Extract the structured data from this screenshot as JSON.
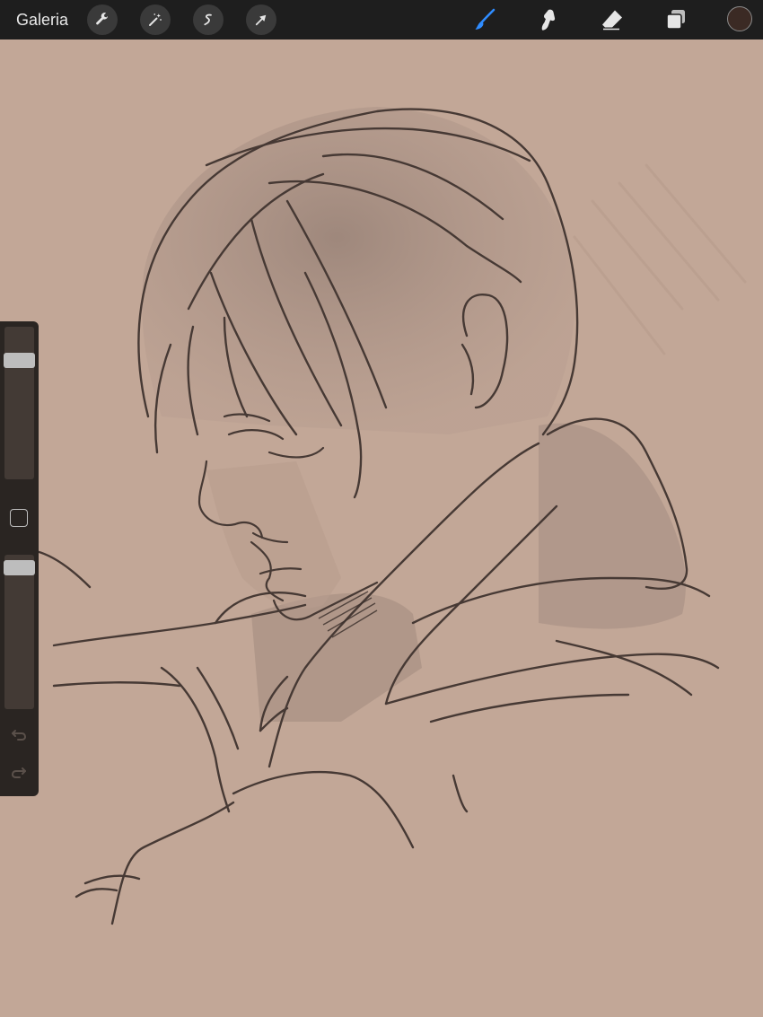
{
  "toolbar": {
    "gallery_label": "Galeria",
    "left_tools": [
      {
        "icon": "wrench-icon"
      },
      {
        "icon": "magic-wand-icon"
      },
      {
        "icon": "selection-s-icon"
      },
      {
        "icon": "transform-arrow-icon"
      }
    ],
    "right_tools": [
      {
        "icon": "brush-icon",
        "active": true
      },
      {
        "icon": "smudge-icon",
        "active": false
      },
      {
        "icon": "eraser-icon",
        "active": false
      },
      {
        "icon": "layers-icon",
        "active": false
      }
    ],
    "current_color": "#3b2a24"
  },
  "sidebar": {
    "brush_size_level": 0.19,
    "opacity_level": 0.04
  },
  "colors": {
    "canvas_bg": "#c2a797",
    "accent": "#2f8cff",
    "toolbar_bg": "#1e1e1e"
  }
}
